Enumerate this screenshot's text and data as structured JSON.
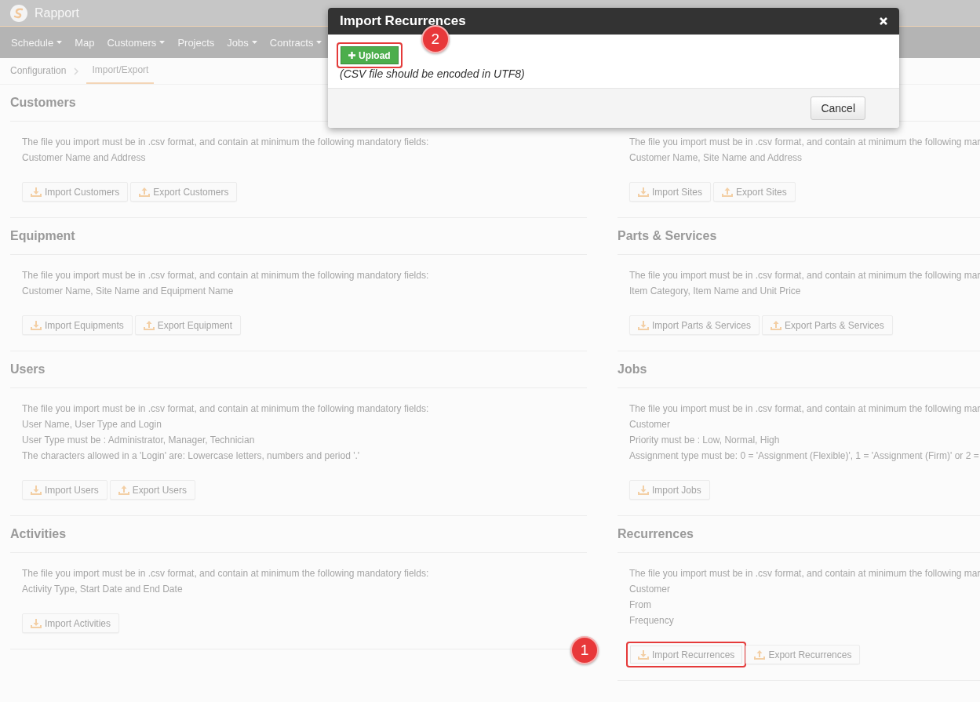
{
  "app": {
    "name": "Rapport"
  },
  "nav": [
    {
      "label": "Schedule",
      "dropdown": true
    },
    {
      "label": "Map",
      "dropdown": false
    },
    {
      "label": "Customers",
      "dropdown": true
    },
    {
      "label": "Projects",
      "dropdown": false
    },
    {
      "label": "Jobs",
      "dropdown": true
    },
    {
      "label": "Contracts",
      "dropdown": true
    }
  ],
  "breadcrumb": [
    {
      "label": "Configuration",
      "selected": false
    },
    {
      "label": "Import/Export",
      "selected": true
    }
  ],
  "columns": [
    [
      {
        "heading": "Customers",
        "lines": [
          "The file you import must be in .csv format, and contain at minimum the following mandatory fields:",
          "Customer Name and Address"
        ],
        "buttons": [
          {
            "label": "Import Customers",
            "kind": "import",
            "highlighted": false
          },
          {
            "label": "Export Customers",
            "kind": "export",
            "highlighted": false
          }
        ]
      },
      {
        "heading": "Equipment",
        "lines": [
          "The file you import must be in .csv format, and contain at minimum the following mandatory fields:",
          "Customer Name, Site Name and Equipment Name"
        ],
        "buttons": [
          {
            "label": "Import Equipments",
            "kind": "import",
            "highlighted": false
          },
          {
            "label": "Export Equipment",
            "kind": "export",
            "highlighted": false
          }
        ]
      },
      {
        "heading": "Users",
        "lines": [
          "The file you import must be in .csv format, and contain at minimum the following mandatory fields:",
          "User Name, User Type and Login",
          "User Type must be : Administrator, Manager, Technician",
          "The characters allowed in a 'Login' are: Lowercase letters, numbers and period '.'"
        ],
        "buttons": [
          {
            "label": "Import Users",
            "kind": "import",
            "highlighted": false
          },
          {
            "label": "Export Users",
            "kind": "export",
            "highlighted": false
          }
        ]
      },
      {
        "heading": "Activities",
        "lines": [
          "The file you import must be in .csv format, and contain at minimum the following mandatory fields:",
          "Activity Type, Start Date and End Date"
        ],
        "buttons": [
          {
            "label": "Import Activities",
            "kind": "import",
            "highlighted": false
          }
        ]
      }
    ],
    [
      {
        "lines": [
          "The file you import must be in .csv format, and contain at minimum the following mar",
          "Customer Name, Site Name and Address"
        ],
        "buttons": [
          {
            "label": "Import Sites",
            "kind": "import",
            "highlighted": false
          },
          {
            "label": "Export Sites",
            "kind": "export",
            "highlighted": false
          }
        ]
      },
      {
        "heading": "Parts & Services",
        "lines": [
          "The file you import must be in .csv format, and contain at minimum the following mar",
          "Item Category, Item Name and Unit Price"
        ],
        "buttons": [
          {
            "label": "Import Parts & Services",
            "kind": "import",
            "highlighted": false
          },
          {
            "label": "Export Parts & Services",
            "kind": "export",
            "highlighted": false
          }
        ]
      },
      {
        "heading": "Jobs",
        "lines": [
          "The file you import must be in .csv format, and contain at minimum the following mar",
          "Customer",
          "Priority must be : Low, Normal, High",
          "Assignment type must be: 0 = 'Assignment (Flexible)', 1 = 'Assignment (Firm)' or 2 ="
        ],
        "buttons": [
          {
            "label": "Import Jobs",
            "kind": "import",
            "highlighted": false
          }
        ]
      },
      {
        "heading": "Recurrences",
        "lines": [
          "The file you import must be in .csv format, and contain at minimum the following mar",
          "Customer",
          "From",
          "Frequency"
        ],
        "buttons": [
          {
            "label": "Import Recurrences",
            "kind": "import",
            "highlighted": true,
            "callout": "1"
          },
          {
            "label": "Export Recurrences",
            "kind": "export",
            "highlighted": false
          }
        ]
      }
    ]
  ],
  "modal": {
    "title": "Import Recurrences",
    "upload": {
      "label": "Upload",
      "highlighted": true,
      "callout": "2"
    },
    "note": "(CSV file should be encoded in UTF8)",
    "cancel": "Cancel"
  }
}
